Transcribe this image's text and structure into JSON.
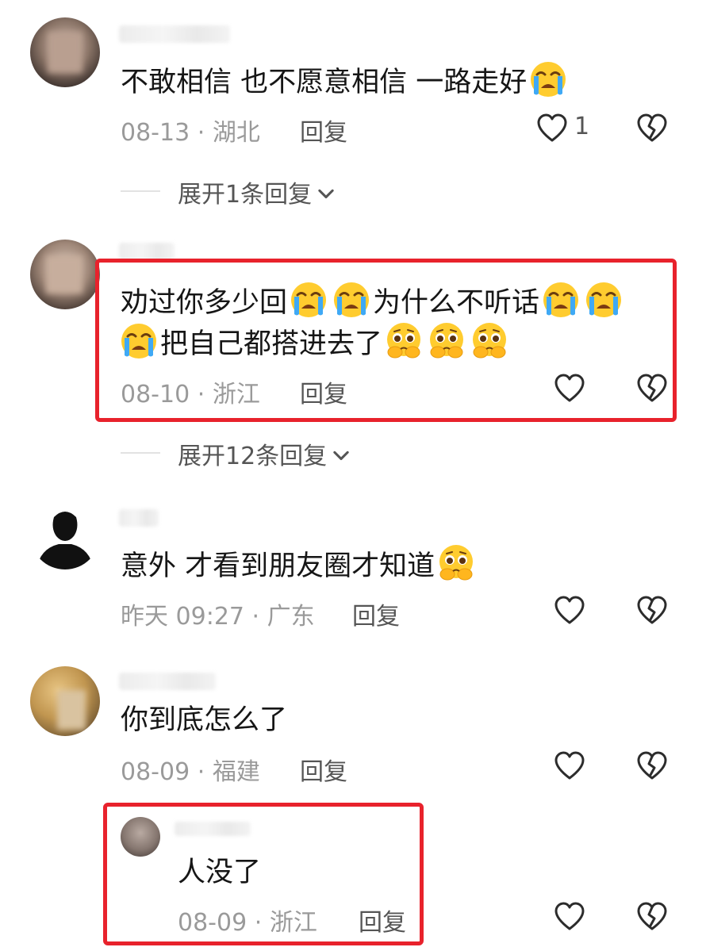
{
  "comments": [
    {
      "text": "不敢相信 也不愿意相信 一路走好",
      "date": "08-13",
      "location": "湖北",
      "reply_label": "回复",
      "like_count": "1",
      "expand_label": "展开1条回复",
      "emoji": [
        "loudly-crying"
      ]
    },
    {
      "text_a": "劝过你多少回",
      "text_b": "为什么不听话",
      "text_c": "把自己都搭进去了",
      "date": "08-10",
      "location": "浙江",
      "reply_label": "回复",
      "expand_label": "展开12条回复",
      "emoji": [
        "loudly-crying",
        "loudly-crying",
        "loudly-crying",
        "loudly-crying",
        "loudly-crying",
        "holding-back-tears",
        "holding-back-tears",
        "holding-back-tears"
      ]
    },
    {
      "text": "意外 才看到朋友圈才知道",
      "date": "昨天 09:27",
      "location": "广东",
      "reply_label": "回复",
      "emoji": [
        "holding-back-tears"
      ]
    },
    {
      "text": "你到底怎么了",
      "date": "08-09",
      "location": "福建",
      "reply_label": "回复"
    }
  ],
  "sub_reply": {
    "text": "人没了",
    "date": "08-09",
    "location": "浙江",
    "reply_label": "回复"
  },
  "separator": "·",
  "colors": {
    "highlight": "#e8222c",
    "meta": "#9a9a9a",
    "text": "#161616"
  },
  "icons": [
    "heart-icon",
    "broken-heart-icon",
    "chevron-down-icon"
  ]
}
